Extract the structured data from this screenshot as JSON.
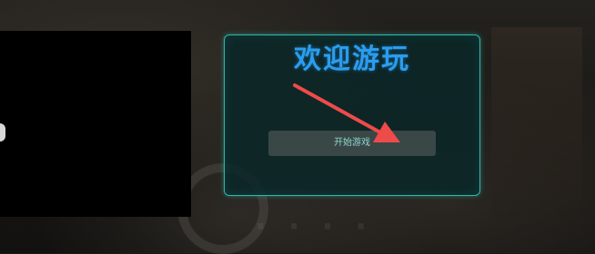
{
  "dialog": {
    "title": "欢迎游玩",
    "start_button_label": "开始游戏"
  },
  "colors": {
    "dialog_border": "#2fb9b0",
    "title_text": "#2a9df0",
    "button_bg": "#3a4747",
    "button_text": "#8fd6cd",
    "annotation_arrow": "#ee4b4b"
  },
  "icons": {
    "annotation": "arrow-icon"
  }
}
